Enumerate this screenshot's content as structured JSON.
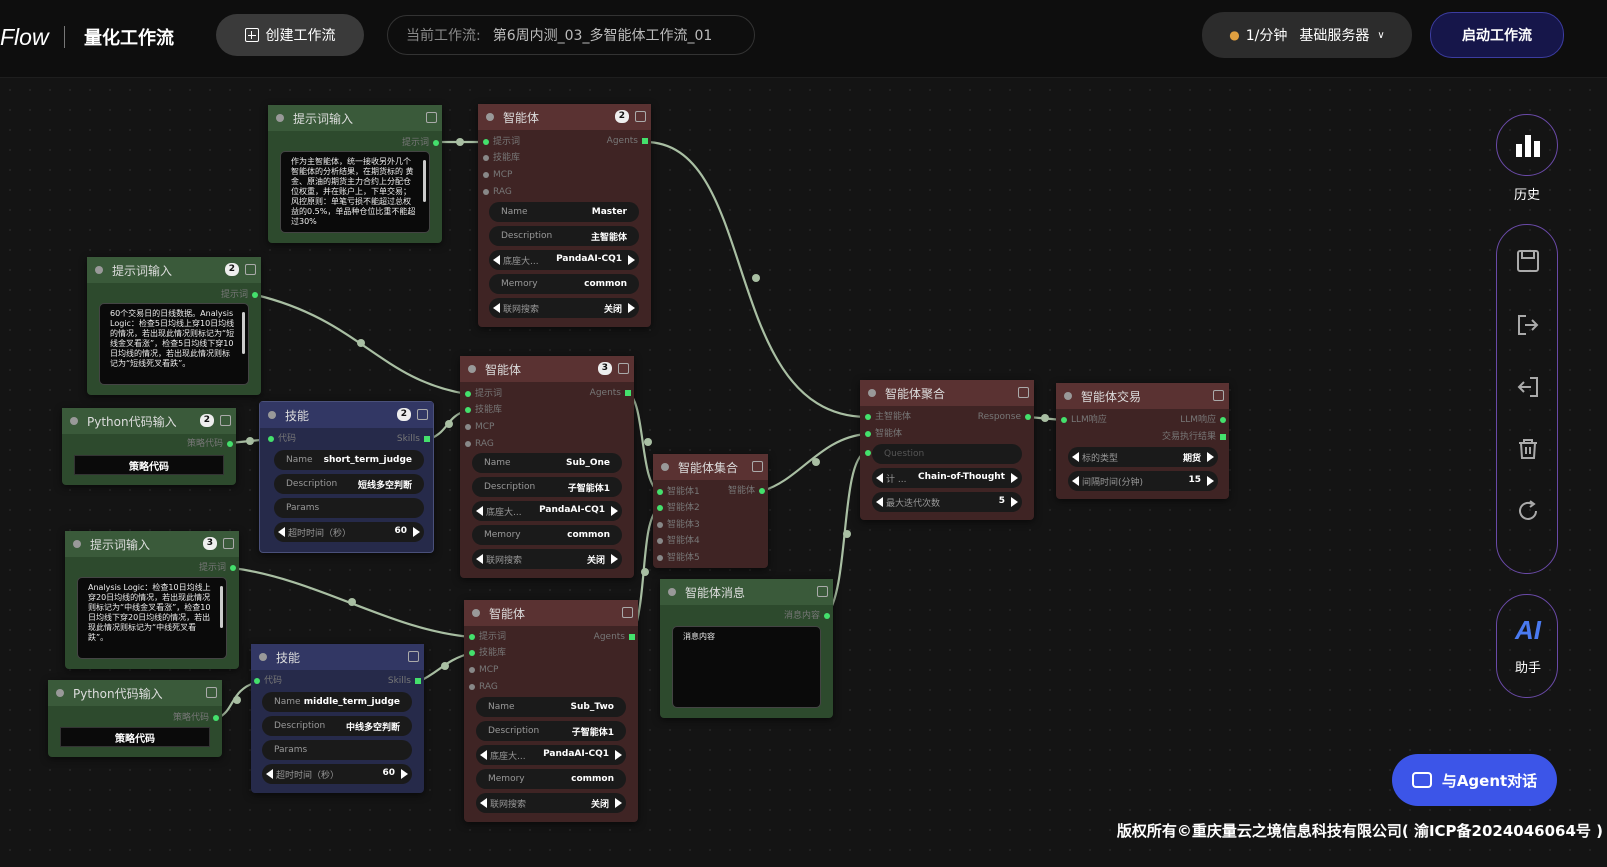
{
  "header": {
    "brand": "Flow",
    "title": "量化工作流",
    "create_label": "创建工作流",
    "current_label": "当前工作流:",
    "current_value": "第6周内测_03_多智能体工作流_01",
    "rate": "1/分钟",
    "server": "基础服务器",
    "start_label": "启动工作流"
  },
  "side": {
    "history": "历史",
    "ai": "AI",
    "assistant": "助手"
  },
  "agent_chat": "与Agent对话",
  "footer": "版权所有©重庆量云之境信息科技有限公司( 渝ICP备2024046064号 )",
  "nodes": {
    "prompt1": {
      "title": "提示词输入",
      "out": "提示词",
      "text": "作为主智能体，统一接收另外几个智能体的分析结果，在期货标的 黄金、原油的期货主力合约上分配仓位权重，并在账户上，下单交易；风控原则：单笔亏损不能超过总权益的0.5%，单品种仓位比重不能超过30%"
    },
    "prompt2": {
      "title": "提示词输入",
      "badge": "2",
      "out": "提示词",
      "text": "60个交易日的日线数据。Analysis Logic：检查5日均线上穿10日均线的情况，若出现此情况则标记为“短线金叉看涨”，检查5日均线下穿10日均线的情况，若出现此情况则标记为“短线死叉看跌”。"
    },
    "python1": {
      "title": "Python代码输入",
      "badge": "2",
      "out": "策略代码",
      "code": "策略代码"
    },
    "prompt3": {
      "title": "提示词输入",
      "badge": "3",
      "out": "提示词",
      "text": "Analysis Logic：检查10日均线上穿20日均线的情况，若出现此情况则标记为“中线金叉看涨”，检查10日均线下穿20日均线的情况，若出现此情况则标记为“中线死叉看跌”。"
    },
    "python2": {
      "title": "Python代码输入",
      "out": "策略代码",
      "code": "策略代码"
    },
    "skill1": {
      "title": "技能",
      "badge": "2",
      "in": "代码",
      "out": "Skills",
      "name": "short_term_judge",
      "desc": "短线多空判断",
      "params": "Params",
      "timeout_label": "超时时间（秒）",
      "timeout": "60"
    },
    "skill2": {
      "title": "技能",
      "in": "代码",
      "out": "Skills",
      "name": "middle_term_judge",
      "desc": "中线多空判断",
      "params": "Params",
      "timeout_label": "超时时间（秒）",
      "timeout": "60"
    },
    "agentMaster": {
      "title": "智能体",
      "badge": "2",
      "out": "Agents",
      "ports": [
        "提示词",
        "技能库",
        "MCP",
        "RAG"
      ],
      "name": "Master",
      "desc": "主智能体",
      "model_label": "底座大...",
      "model": "PandaAI-CQ1",
      "memory": "common",
      "search_label": "联网搜索",
      "search": "关闭"
    },
    "agentOne": {
      "title": "智能体",
      "badge": "3",
      "out": "Agents",
      "ports": [
        "提示词",
        "技能库",
        "MCP",
        "RAG"
      ],
      "name": "Sub_One",
      "desc": "子智能体1",
      "model_label": "底座大...",
      "model": "PandaAI-CQ1",
      "memory": "common",
      "search_label": "联网搜索",
      "search": "关闭"
    },
    "agentTwo": {
      "title": "智能体",
      "out": "Agents",
      "ports": [
        "提示词",
        "技能库",
        "MCP",
        "RAG"
      ],
      "name": "Sub_Two",
      "desc": "子智能体1",
      "model_label": "底座大...",
      "model": "PandaAI-CQ1",
      "memory": "common",
      "search_label": "联网搜索",
      "search": "关闭"
    },
    "collect": {
      "title": "智能体集合",
      "ports": [
        "智能体1",
        "智能体2",
        "智能体3",
        "智能体4",
        "智能体5"
      ],
      "out": "智能体"
    },
    "msg": {
      "title": "智能体消息",
      "out": "消息内容",
      "text": "消息内容"
    },
    "aggr": {
      "title": "智能体聚合",
      "ports": [
        "主智能体",
        "智能体",
        ""
      ],
      "out": "Response",
      "question": "Question",
      "cot_label": "计 ...",
      "cot": "Chain-of-Thought",
      "iter_label": "最大迭代次数",
      "iter": "5"
    },
    "trade": {
      "title": "智能体交易",
      "in": "LLM响应",
      "out1": "LLM响应",
      "out2": "交易执行结果",
      "type_label": "标的类型",
      "type": "期货",
      "interval_label": "间隔时间(分钟)",
      "interval": "15"
    }
  },
  "labels": {
    "name": "Name",
    "description": "Description",
    "memory": "Memory"
  }
}
